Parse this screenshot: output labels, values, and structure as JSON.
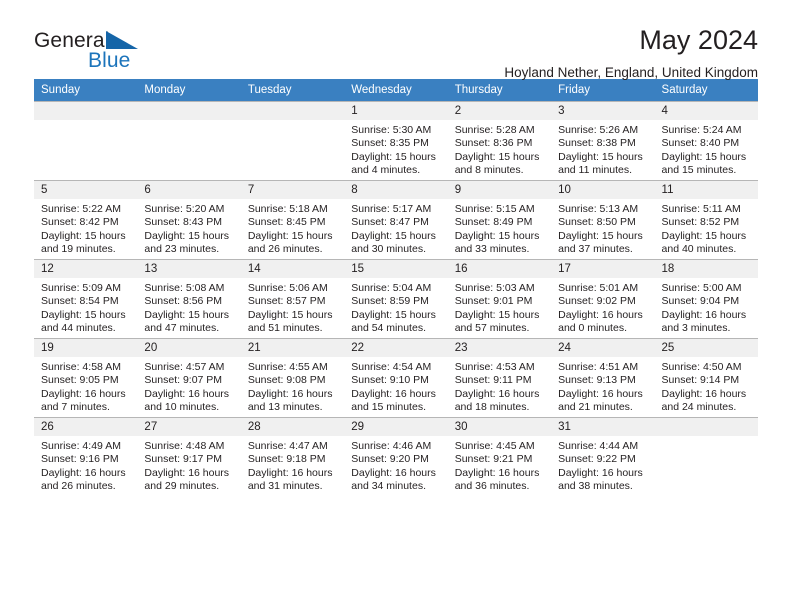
{
  "brand": {
    "name_part1": "General",
    "name_part2": "Blue",
    "triangle_color": "#1565a8",
    "blue_color": "#1c74bb"
  },
  "header": {
    "title": "May 2024",
    "subtitle": "Hoyland Nether, England, United Kingdom"
  },
  "theme": {
    "header_row_background": "#3a80c1",
    "header_row_text": "#ffffff",
    "daynum_background": "#f0f0f0",
    "cell_border": "#b6b6b6",
    "text": "#231f20"
  },
  "calendar": {
    "weekday_headers": [
      "Sunday",
      "Monday",
      "Tuesday",
      "Wednesday",
      "Thursday",
      "Friday",
      "Saturday"
    ],
    "weeks": [
      [
        {
          "day": "",
          "empty": true
        },
        {
          "day": "",
          "empty": true
        },
        {
          "day": "",
          "empty": true
        },
        {
          "day": "1",
          "sunrise": "Sunrise: 5:30 AM",
          "sunset": "Sunset: 8:35 PM",
          "daylight": "Daylight: 15 hours and 4 minutes."
        },
        {
          "day": "2",
          "sunrise": "Sunrise: 5:28 AM",
          "sunset": "Sunset: 8:36 PM",
          "daylight": "Daylight: 15 hours and 8 minutes."
        },
        {
          "day": "3",
          "sunrise": "Sunrise: 5:26 AM",
          "sunset": "Sunset: 8:38 PM",
          "daylight": "Daylight: 15 hours and 11 minutes."
        },
        {
          "day": "4",
          "sunrise": "Sunrise: 5:24 AM",
          "sunset": "Sunset: 8:40 PM",
          "daylight": "Daylight: 15 hours and 15 minutes."
        }
      ],
      [
        {
          "day": "5",
          "sunrise": "Sunrise: 5:22 AM",
          "sunset": "Sunset: 8:42 PM",
          "daylight": "Daylight: 15 hours and 19 minutes."
        },
        {
          "day": "6",
          "sunrise": "Sunrise: 5:20 AM",
          "sunset": "Sunset: 8:43 PM",
          "daylight": "Daylight: 15 hours and 23 minutes."
        },
        {
          "day": "7",
          "sunrise": "Sunrise: 5:18 AM",
          "sunset": "Sunset: 8:45 PM",
          "daylight": "Daylight: 15 hours and 26 minutes."
        },
        {
          "day": "8",
          "sunrise": "Sunrise: 5:17 AM",
          "sunset": "Sunset: 8:47 PM",
          "daylight": "Daylight: 15 hours and 30 minutes."
        },
        {
          "day": "9",
          "sunrise": "Sunrise: 5:15 AM",
          "sunset": "Sunset: 8:49 PM",
          "daylight": "Daylight: 15 hours and 33 minutes."
        },
        {
          "day": "10",
          "sunrise": "Sunrise: 5:13 AM",
          "sunset": "Sunset: 8:50 PM",
          "daylight": "Daylight: 15 hours and 37 minutes."
        },
        {
          "day": "11",
          "sunrise": "Sunrise: 5:11 AM",
          "sunset": "Sunset: 8:52 PM",
          "daylight": "Daylight: 15 hours and 40 minutes."
        }
      ],
      [
        {
          "day": "12",
          "sunrise": "Sunrise: 5:09 AM",
          "sunset": "Sunset: 8:54 PM",
          "daylight": "Daylight: 15 hours and 44 minutes."
        },
        {
          "day": "13",
          "sunrise": "Sunrise: 5:08 AM",
          "sunset": "Sunset: 8:56 PM",
          "daylight": "Daylight: 15 hours and 47 minutes."
        },
        {
          "day": "14",
          "sunrise": "Sunrise: 5:06 AM",
          "sunset": "Sunset: 8:57 PM",
          "daylight": "Daylight: 15 hours and 51 minutes."
        },
        {
          "day": "15",
          "sunrise": "Sunrise: 5:04 AM",
          "sunset": "Sunset: 8:59 PM",
          "daylight": "Daylight: 15 hours and 54 minutes."
        },
        {
          "day": "16",
          "sunrise": "Sunrise: 5:03 AM",
          "sunset": "Sunset: 9:01 PM",
          "daylight": "Daylight: 15 hours and 57 minutes."
        },
        {
          "day": "17",
          "sunrise": "Sunrise: 5:01 AM",
          "sunset": "Sunset: 9:02 PM",
          "daylight": "Daylight: 16 hours and 0 minutes."
        },
        {
          "day": "18",
          "sunrise": "Sunrise: 5:00 AM",
          "sunset": "Sunset: 9:04 PM",
          "daylight": "Daylight: 16 hours and 3 minutes."
        }
      ],
      [
        {
          "day": "19",
          "sunrise": "Sunrise: 4:58 AM",
          "sunset": "Sunset: 9:05 PM",
          "daylight": "Daylight: 16 hours and 7 minutes."
        },
        {
          "day": "20",
          "sunrise": "Sunrise: 4:57 AM",
          "sunset": "Sunset: 9:07 PM",
          "daylight": "Daylight: 16 hours and 10 minutes."
        },
        {
          "day": "21",
          "sunrise": "Sunrise: 4:55 AM",
          "sunset": "Sunset: 9:08 PM",
          "daylight": "Daylight: 16 hours and 13 minutes."
        },
        {
          "day": "22",
          "sunrise": "Sunrise: 4:54 AM",
          "sunset": "Sunset: 9:10 PM",
          "daylight": "Daylight: 16 hours and 15 minutes."
        },
        {
          "day": "23",
          "sunrise": "Sunrise: 4:53 AM",
          "sunset": "Sunset: 9:11 PM",
          "daylight": "Daylight: 16 hours and 18 minutes."
        },
        {
          "day": "24",
          "sunrise": "Sunrise: 4:51 AM",
          "sunset": "Sunset: 9:13 PM",
          "daylight": "Daylight: 16 hours and 21 minutes."
        },
        {
          "day": "25",
          "sunrise": "Sunrise: 4:50 AM",
          "sunset": "Sunset: 9:14 PM",
          "daylight": "Daylight: 16 hours and 24 minutes."
        }
      ],
      [
        {
          "day": "26",
          "sunrise": "Sunrise: 4:49 AM",
          "sunset": "Sunset: 9:16 PM",
          "daylight": "Daylight: 16 hours and 26 minutes."
        },
        {
          "day": "27",
          "sunrise": "Sunrise: 4:48 AM",
          "sunset": "Sunset: 9:17 PM",
          "daylight": "Daylight: 16 hours and 29 minutes."
        },
        {
          "day": "28",
          "sunrise": "Sunrise: 4:47 AM",
          "sunset": "Sunset: 9:18 PM",
          "daylight": "Daylight: 16 hours and 31 minutes."
        },
        {
          "day": "29",
          "sunrise": "Sunrise: 4:46 AM",
          "sunset": "Sunset: 9:20 PM",
          "daylight": "Daylight: 16 hours and 34 minutes."
        },
        {
          "day": "30",
          "sunrise": "Sunrise: 4:45 AM",
          "sunset": "Sunset: 9:21 PM",
          "daylight": "Daylight: 16 hours and 36 minutes."
        },
        {
          "day": "31",
          "sunrise": "Sunrise: 4:44 AM",
          "sunset": "Sunset: 9:22 PM",
          "daylight": "Daylight: 16 hours and 38 minutes."
        },
        {
          "day": "",
          "empty": true
        }
      ]
    ]
  }
}
